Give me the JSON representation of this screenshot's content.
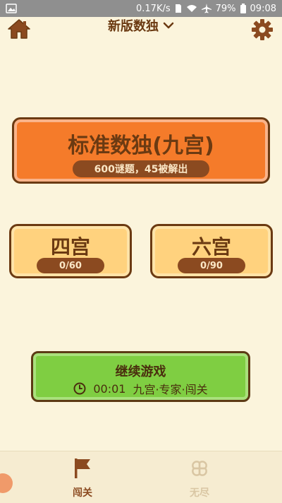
{
  "status_bar": {
    "speed": "0.17K/s",
    "battery": "79%",
    "time": "09:08"
  },
  "header": {
    "mode": "新版数独",
    "icons": [
      "home-icon",
      "chevron-down-icon",
      "gear-icon"
    ]
  },
  "cards": {
    "standard": {
      "title": "标准数独(九宫)",
      "stats": "600谜题，45被解出"
    },
    "four": {
      "title": "四宫",
      "progress": "0/60"
    },
    "six": {
      "title": "六宫",
      "progress": "0/90"
    }
  },
  "continue": {
    "label": "继续游戏",
    "time": "00:01",
    "detail": "九宫·专家·闯关"
  },
  "bottom_nav": {
    "level": "闯关",
    "endless": "无尽"
  },
  "colors": {
    "background": "#fbf4dc",
    "orange": "#f57b2a",
    "yellow": "#ffd27e",
    "green": "#7fce42",
    "brown": "#6b3a12"
  }
}
